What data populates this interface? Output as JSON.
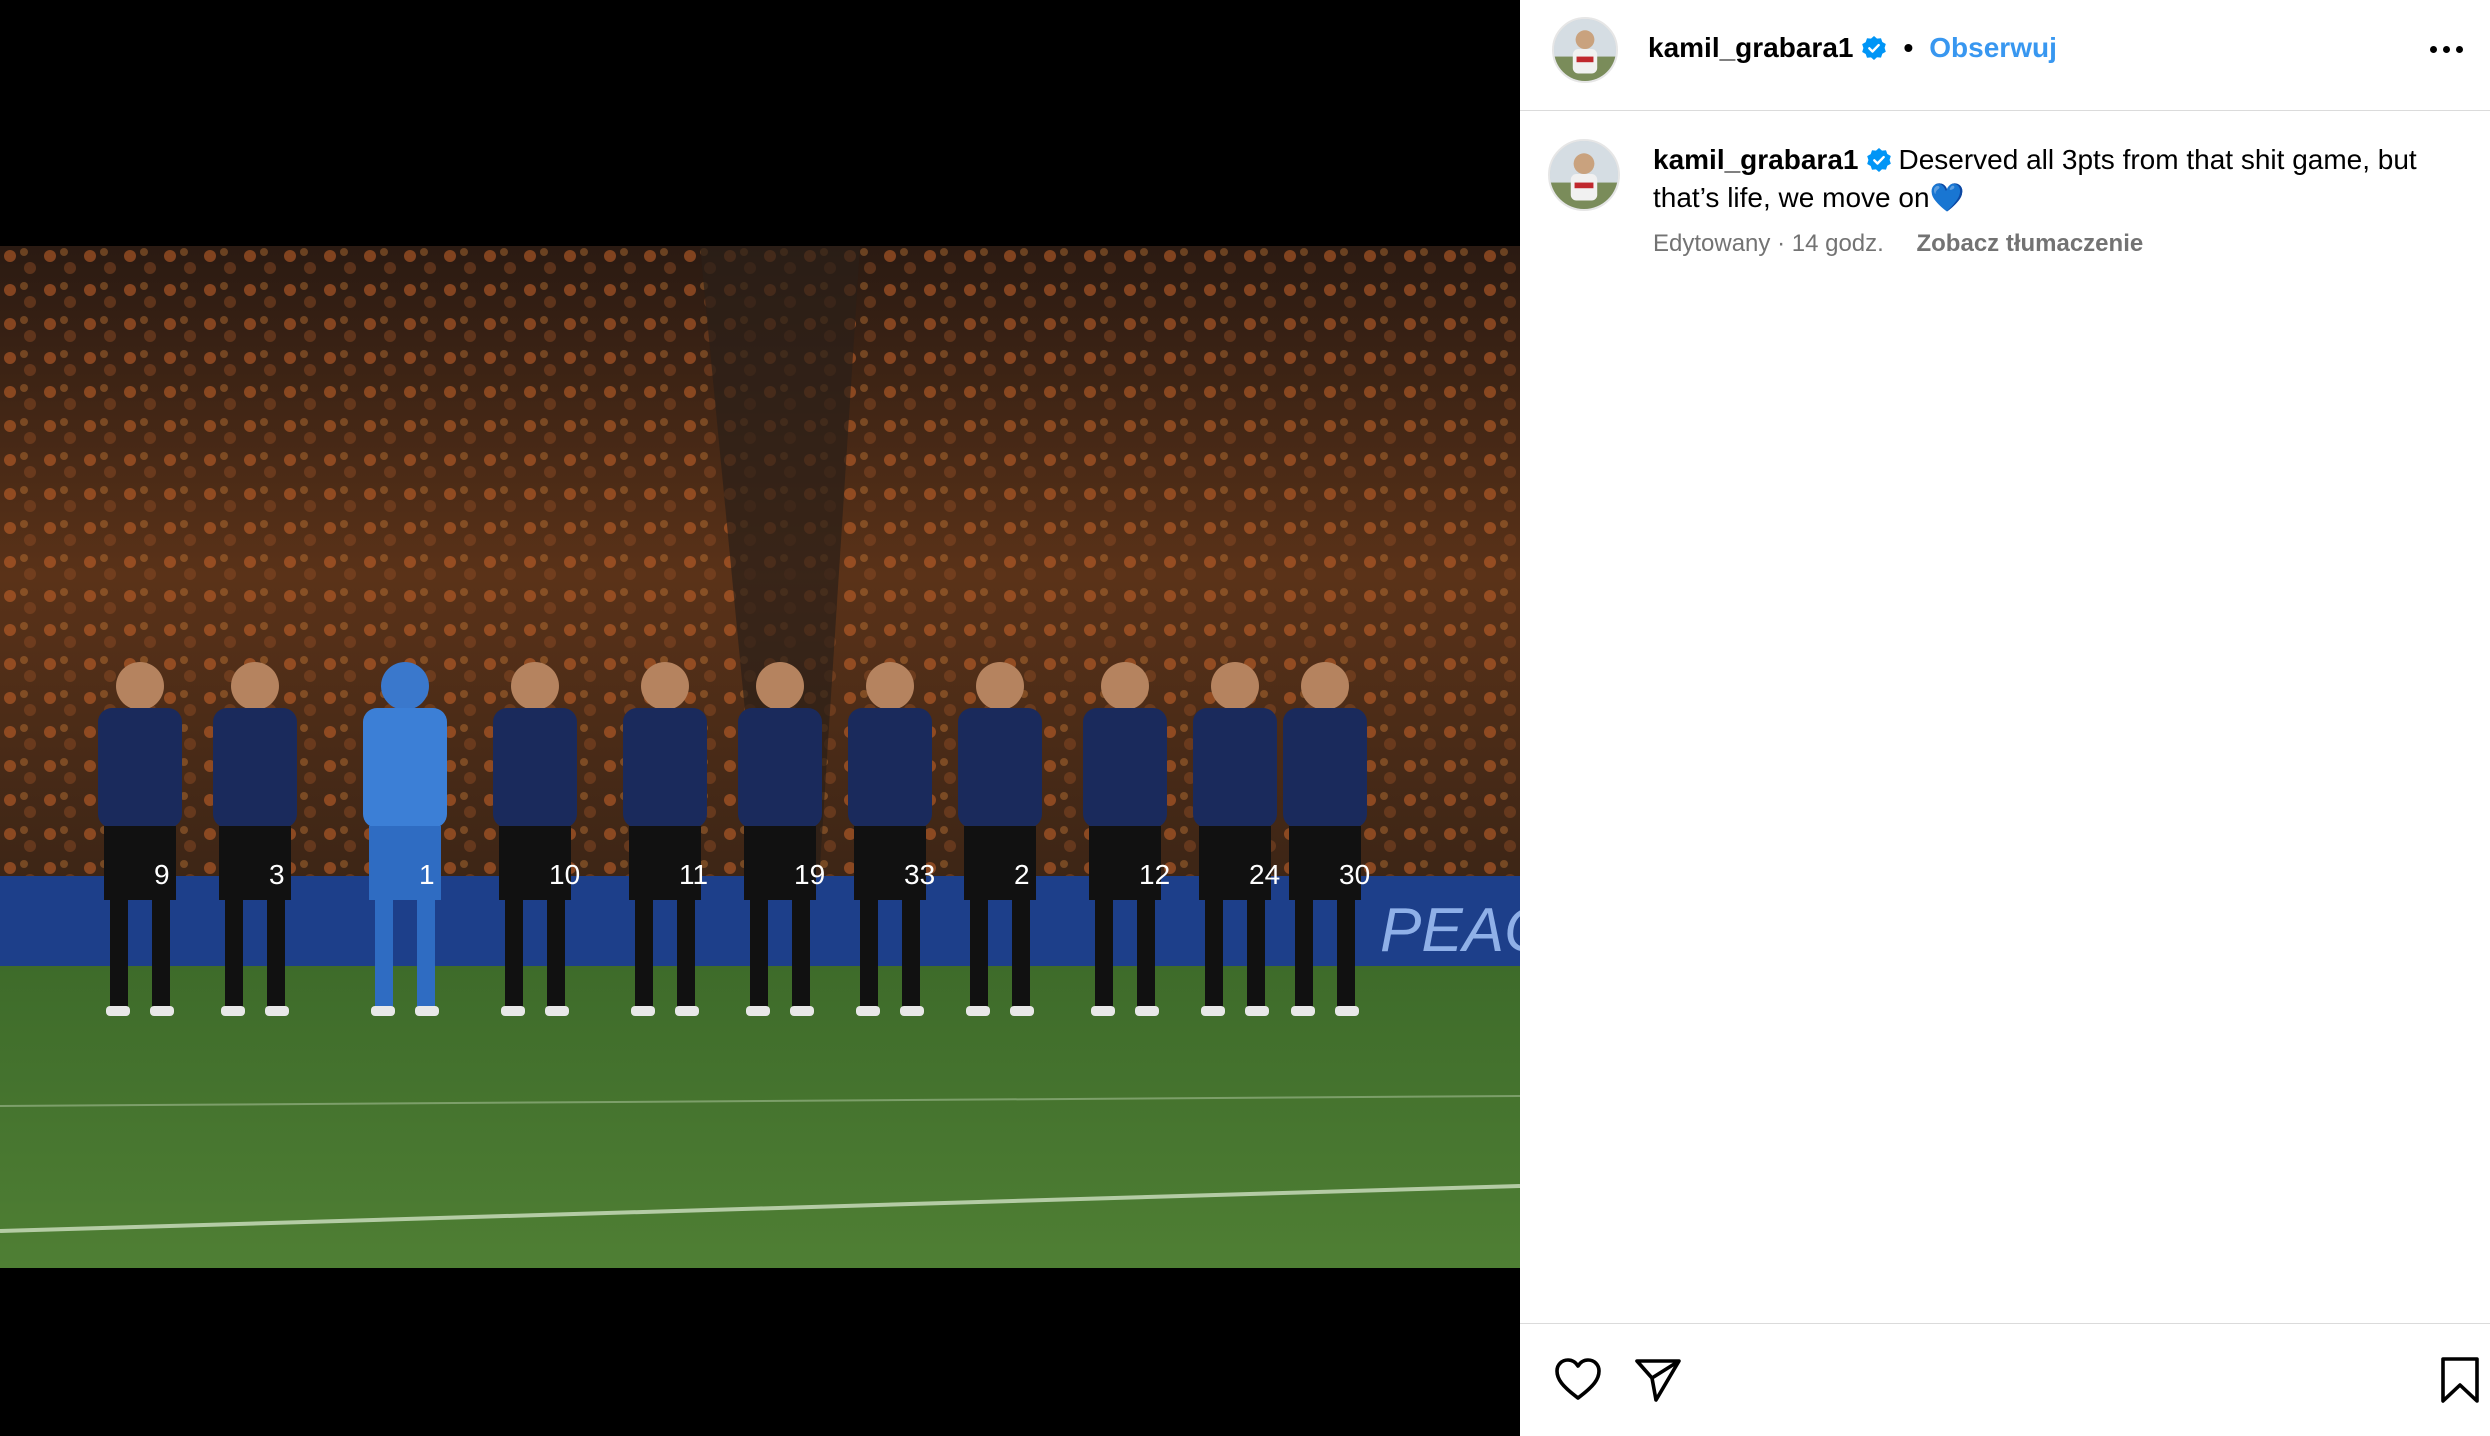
{
  "media": {
    "alt": "",
    "shirt_numbers": [
      "9",
      "3",
      "1",
      "10",
      "11",
      "19",
      "33",
      "2",
      "12",
      "24",
      "30"
    ],
    "banner_text": "PEAC"
  },
  "post": {
    "username": "kamil_grabara1",
    "separator": "•",
    "follow_label": "Obserwuj",
    "caption_text": "Deserved all 3pts from that shit game, but that’s life, we move on💙",
    "edited_label": "Edytowany",
    "meta_separator": " · ",
    "time_ago": "14 godz.",
    "translate_label": "Zobacz tłumaczenie"
  },
  "colors": {
    "accent": "#3897f0",
    "verified": "#0095f6",
    "secondary_text": "#737373",
    "divider": "#dbdbdb"
  },
  "icons": {
    "verified": "verified-badge-icon",
    "more": "more-options-icon",
    "like": "heart-icon",
    "share": "paper-plane-icon",
    "save": "bookmark-icon"
  }
}
